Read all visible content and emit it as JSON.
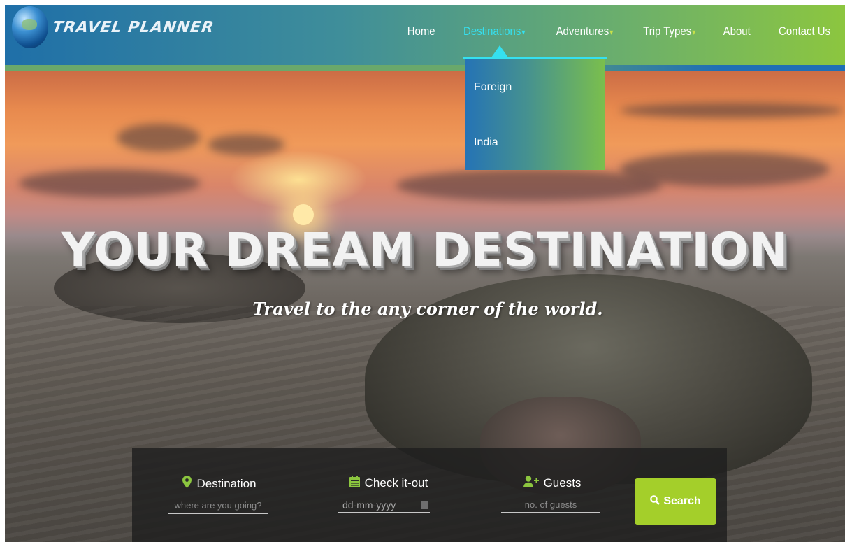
{
  "brand": {
    "name": "TRAVEL PLANNER",
    "logo_icon": "globe-icon"
  },
  "nav": {
    "items": [
      {
        "label": "Home",
        "caret": ""
      },
      {
        "label": "Destinations",
        "caret": "▾"
      },
      {
        "label": "Adventures",
        "caret": "▾"
      },
      {
        "label": "Trip Types",
        "caret": "▾"
      },
      {
        "label": "About",
        "caret": ""
      },
      {
        "label": "Contact Us",
        "caret": ""
      }
    ],
    "active": "Destinations"
  },
  "dropdown": {
    "items": [
      "Foreign",
      "India"
    ]
  },
  "hero": {
    "headline": "YOUR DREAM DESTINATION",
    "tagline": "Travel to the any corner of the world."
  },
  "booking": {
    "destination": {
      "label": "Destination",
      "placeholder": "where are you going?",
      "icon": "map-pin-icon"
    },
    "checkout": {
      "label": "Check it-out",
      "value": "dd-mm-yyyy",
      "icon": "calendar-icon"
    },
    "guests": {
      "label": "Guests",
      "placeholder": "no. of guests",
      "icon": "add-user-icon"
    },
    "search": {
      "label": "Search",
      "icon": "search-icon"
    }
  },
  "colors": {
    "header_start": "#1f6fa8",
    "header_end": "#8cc63f",
    "active_nav": "#35e0f0",
    "caret": "#c8e04a",
    "search_button": "#a4cf2a",
    "icon_green": "#8cc63f"
  }
}
